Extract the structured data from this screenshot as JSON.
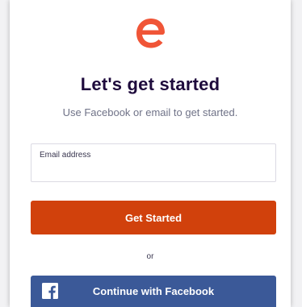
{
  "brand": {
    "logo_icon": "eventbrite-e-logo-icon",
    "accent": "#d1410c"
  },
  "heading": "Let's get started",
  "subheading": "Use Facebook or email to get started.",
  "email": {
    "label": "Email address",
    "value": "",
    "placeholder": ""
  },
  "primary_button": "Get Started",
  "divider": "or",
  "facebook_button": {
    "label": "Continue with Facebook",
    "icon": "facebook-icon",
    "color": "#3b5998"
  }
}
